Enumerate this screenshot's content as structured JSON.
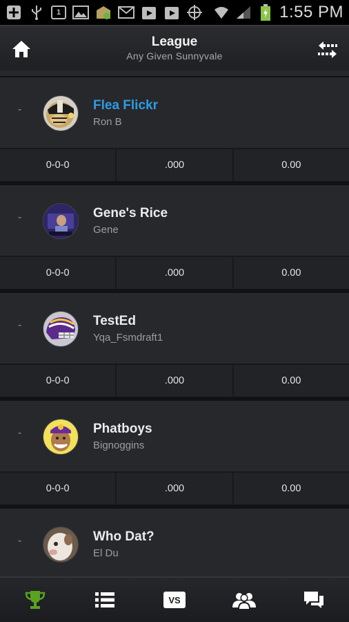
{
  "status_bar": {
    "time": "1:55 PM"
  },
  "header": {
    "title": "League",
    "subtitle": "Any Given Sunnyvale"
  },
  "teams": [
    {
      "rank": "-",
      "name": "Flea Flickr",
      "owner": "Ron B",
      "record": "0-0-0",
      "pct": ".000",
      "points": "0.00",
      "highlighted": true
    },
    {
      "rank": "-",
      "name": "Gene's Rice",
      "owner": "Gene",
      "record": "0-0-0",
      "pct": ".000",
      "points": "0.00"
    },
    {
      "rank": "-",
      "name": "TestEd",
      "owner": "Yqa_Fsmdraft1",
      "record": "0-0-0",
      "pct": ".000",
      "points": "0.00"
    },
    {
      "rank": "-",
      "name": "Phatboys",
      "owner": "Bignoggins",
      "record": "0-0-0",
      "pct": ".000",
      "points": "0.00"
    },
    {
      "rank": "-",
      "name": "Who Dat?",
      "owner": "El Du"
    }
  ],
  "bottom_nav": {
    "vs_label": "VS",
    "active_color": "#5aa31e",
    "icons": [
      "trophy-icon",
      "list-icon",
      "vs-icon",
      "group-icon",
      "chat-icon"
    ]
  },
  "colors": {
    "highlight": "#2f9be3",
    "background": "#27282c"
  }
}
